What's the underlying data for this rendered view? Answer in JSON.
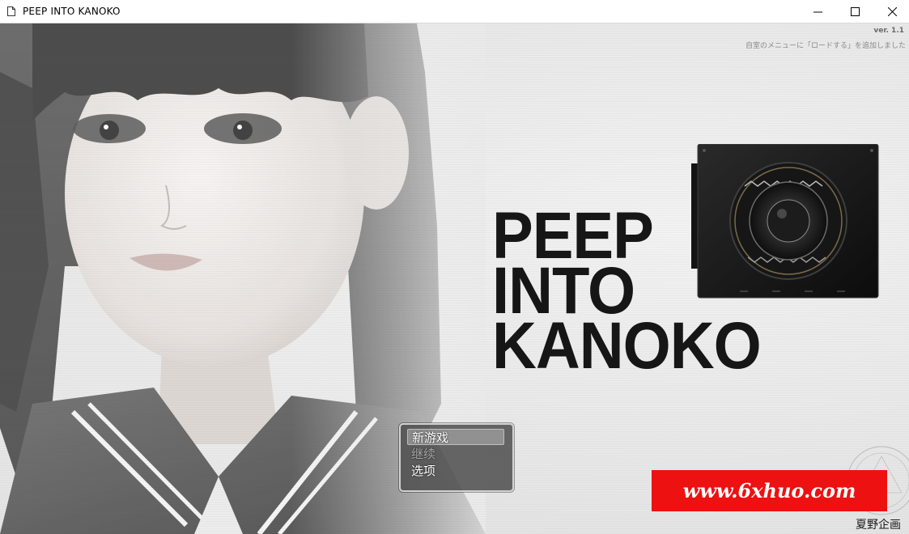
{
  "window": {
    "title": "PEEP INTO KANOKO",
    "icons": {
      "app": "document-icon",
      "minimize": "minimize-icon",
      "maximize": "maximize-icon",
      "close": "close-icon"
    }
  },
  "game": {
    "version": "ver. 1.1",
    "update_note": "自室のメニューに「ロードする」を追加しました",
    "logo_lines": [
      "PEEP",
      "INTO",
      "KANOKO"
    ],
    "menu": {
      "items": [
        {
          "label": "新游戏",
          "selected": true,
          "enabled": true
        },
        {
          "label": "继续",
          "selected": false,
          "enabled": false
        },
        {
          "label": "选项",
          "selected": false,
          "enabled": true
        }
      ]
    },
    "watermark": "www.6xhuo.com",
    "brand": "夏野企画",
    "colors": {
      "menu_bg": "#4e4e4e",
      "watermark_bg": "#ee1111",
      "logo": "#161616"
    }
  }
}
